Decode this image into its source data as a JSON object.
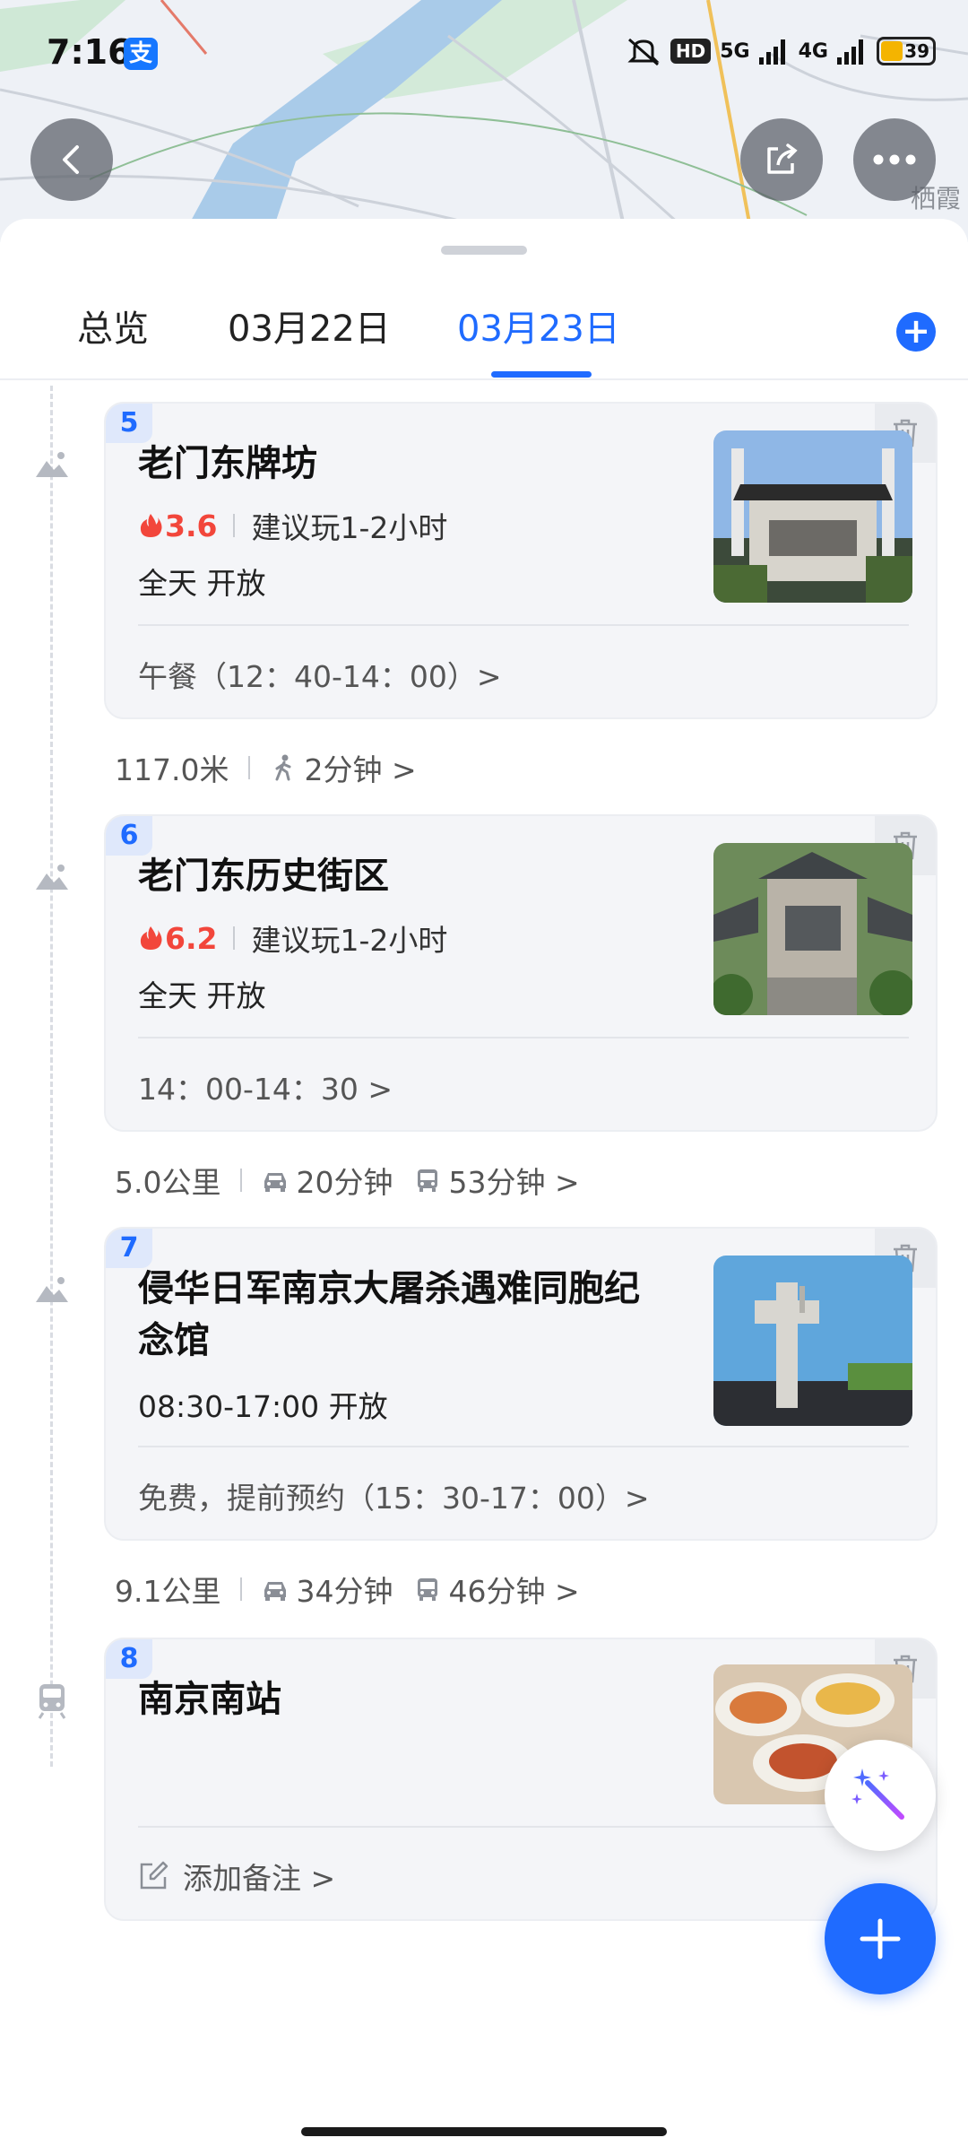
{
  "status_bar": {
    "time": "7:16",
    "app_badge": "支",
    "hd": "HD",
    "net1": "5G",
    "net2": "4G",
    "battery": "39"
  },
  "map": {
    "place_label": "栖霞"
  },
  "tabs": [
    {
      "label": "总览"
    },
    {
      "label": "03月22日"
    },
    {
      "label": "03月23日",
      "active": true
    }
  ],
  "stops": [
    {
      "num": "5",
      "icon": "scenic-icon",
      "title": "老门东牌坊",
      "hot": "3.6",
      "suggest": "建议玩1-2小时",
      "hours": "全天 开放",
      "foot": "午餐（12：40-14：00）>"
    },
    {
      "num": "6",
      "icon": "scenic-icon",
      "title": "老门东历史街区",
      "hot": "6.2",
      "suggest": "建议玩1-2小时",
      "hours": "全天 开放",
      "foot": "14：00-14：30 >"
    },
    {
      "num": "7",
      "icon": "scenic-icon",
      "title_line1": "侵华日军南京大屠杀遇难同胞纪",
      "title_line2": "念馆",
      "hours": "08:30-17:00 开放",
      "foot": "免费，提前预约（15：30-17：00）>"
    },
    {
      "num": "8",
      "icon": "train-station-icon",
      "title": "南京南站",
      "foot": "添加备注 >"
    }
  ],
  "transits": [
    {
      "distance": "117.0米",
      "walk": "2分钟 >"
    },
    {
      "distance": "5.0公里",
      "car": "20分钟",
      "bus": "53分钟 >"
    },
    {
      "distance": "9.1公里",
      "car": "34分钟",
      "bus": "46分钟 >"
    }
  ],
  "colors": {
    "accent": "#1f6bff",
    "hot": "#f2463b",
    "card_bg": "#f4f5f8"
  }
}
